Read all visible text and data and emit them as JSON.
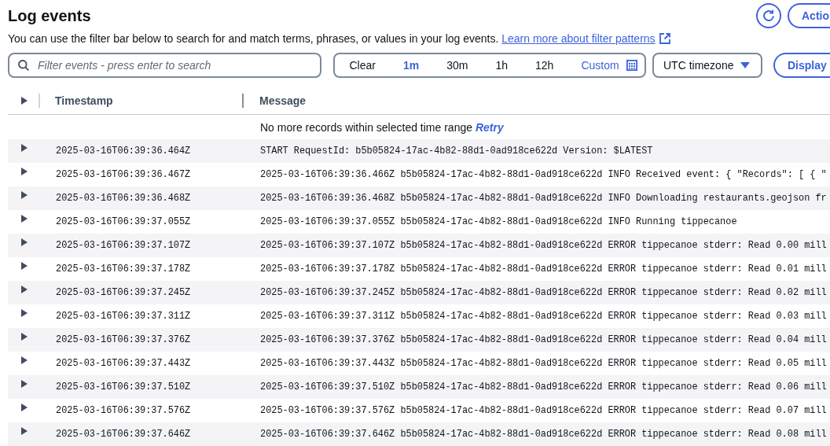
{
  "header": {
    "title": "Log events",
    "button_label": "Actio",
    "description": "You can use the filter bar below to search for and match terms, phrases, or values in your log events.",
    "link": "Learn more about filter patterns"
  },
  "filter_bar": {
    "search": {
      "placeholder": "Filter events - press enter to search"
    },
    "clear": "Clear",
    "ranges": [
      {
        "label": "1m",
        "selected": true
      },
      {
        "label": "30m",
        "selected": false
      },
      {
        "label": "1h",
        "selected": false
      },
      {
        "label": "12h",
        "selected": false
      }
    ],
    "custom": "Custom",
    "timezone": "UTC timezone",
    "display_button": "Display"
  },
  "table": {
    "columns": [
      "Timestamp",
      "Message"
    ],
    "notice": "No more records within selected time range",
    "notice_link": "Retry",
    "rows": [
      {
        "timestamp": "2025-03-16T06:39:36.464Z",
        "message": "START RequestId: b5b05824-17ac-4b82-88d1-0ad918ce622d Version: $LATEST",
        "expanded": false
      },
      {
        "timestamp": "2025-03-16T06:39:36.467Z",
        "message": "2025-03-16T06:39:36.466Z b5b05824-17ac-4b82-88d1-0ad918ce622d INFO Received event: { \"Records\": [ { \"",
        "expanded": false
      },
      {
        "timestamp": "2025-03-16T06:39:36.468Z",
        "message": "2025-03-16T06:39:36.468Z b5b05824-17ac-4b82-88d1-0ad918ce622d INFO Downloading restaurants.geojson fr",
        "expanded": false
      },
      {
        "timestamp": "2025-03-16T06:39:37.055Z",
        "message": "2025-03-16T06:39:37.055Z b5b05824-17ac-4b82-88d1-0ad918ce622d INFO Running tippecanoe",
        "expanded": false
      },
      {
        "timestamp": "2025-03-16T06:39:37.107Z",
        "message": "2025-03-16T06:39:37.107Z b5b05824-17ac-4b82-88d1-0ad918ce622d ERROR tippecanoe stderr: Read 0.00 mill",
        "expanded": false
      },
      {
        "timestamp": "2025-03-16T06:39:37.178Z",
        "message": "2025-03-16T06:39:37.178Z b5b05824-17ac-4b82-88d1-0ad918ce622d ERROR tippecanoe stderr: Read 0.01 mill",
        "expanded": false
      },
      {
        "timestamp": "2025-03-16T06:39:37.245Z",
        "message": "2025-03-16T06:39:37.245Z b5b05824-17ac-4b82-88d1-0ad918ce622d ERROR tippecanoe stderr: Read 0.02 mill",
        "expanded": false
      },
      {
        "timestamp": "2025-03-16T06:39:37.311Z",
        "message": "2025-03-16T06:39:37.311Z b5b05824-17ac-4b82-88d1-0ad918ce622d ERROR tippecanoe stderr: Read 0.03 mill",
        "expanded": false
      },
      {
        "timestamp": "2025-03-16T06:39:37.376Z",
        "message": "2025-03-16T06:39:37.376Z b5b05824-17ac-4b82-88d1-0ad918ce622d ERROR tippecanoe stderr: Read 0.04 mill",
        "expanded": false
      },
      {
        "timestamp": "2025-03-16T06:39:37.443Z",
        "message": "2025-03-16T06:39:37.443Z b5b05824-17ac-4b82-88d1-0ad918ce622d ERROR tippecanoe stderr: Read 0.05 mill",
        "expanded": false
      },
      {
        "timestamp": "2025-03-16T06:39:37.510Z",
        "message": "2025-03-16T06:39:37.510Z b5b05824-17ac-4b82-88d1-0ad918ce622d ERROR tippecanoe stderr: Read 0.06 mill",
        "expanded": false
      },
      {
        "timestamp": "2025-03-16T06:39:37.576Z",
        "message": "2025-03-16T06:39:37.576Z b5b05824-17ac-4b82-88d1-0ad918ce622d ERROR tippecanoe stderr: Read 0.07 mill",
        "expanded": false
      },
      {
        "timestamp": "2025-03-16T06:39:37.646Z",
        "message": "2025-03-16T06:39:37.646Z b5b05824-17ac-4b82-88d1-0ad918ce622d ERROR tippecanoe stderr: Read 0.08 mill",
        "expanded": false
      }
    ]
  }
}
